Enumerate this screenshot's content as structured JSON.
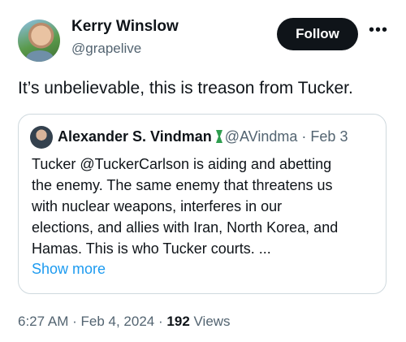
{
  "author": {
    "name": "Kerry Winslow",
    "handle": "@grapelive"
  },
  "actions": {
    "follow_label": "Follow",
    "more_label": "•••"
  },
  "tweet": {
    "text": "It’s unbelievable, this is treason from Tucker."
  },
  "quoted": {
    "name": "Alexander S. Vindman",
    "handle": "@AVindma",
    "separator": "·",
    "date": "Feb 3",
    "lines": [
      "Tucker @TuckerCarlson is aiding and abetting",
      "the enemy. The same enemy that threatens us",
      "with nuclear weapons, interferes in our",
      "elections, and allies with Iran, North Korea, and",
      "Hamas. This is who Tucker courts. ..."
    ],
    "show_more": "Show more"
  },
  "footer": {
    "time": "6:27 AM",
    "dot1": "·",
    "date": "Feb 4, 2024",
    "dot2": "·",
    "views_count": "192",
    "views_label": "Views"
  },
  "colors": {
    "badge_green": "#2e9e4f",
    "link_blue": "#1d9bf0"
  }
}
